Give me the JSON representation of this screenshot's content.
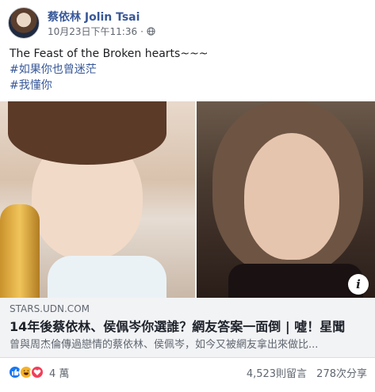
{
  "post": {
    "author": "蔡依林 Jolin Tsai",
    "timestamp": "10月23日下午11:36",
    "separator": "·",
    "privacy_icon": "globe-icon",
    "text_lines": [
      "The Feast of the Broken hearts~~~"
    ],
    "hashtags": [
      "#如果你也曾迷茫",
      "#我懂你"
    ]
  },
  "link_preview": {
    "domain": "STARS.UDN.COM",
    "title": "14年後蔡依林、侯佩岑你選誰？網友答案一面倒 | 噓！星聞",
    "description": "曾與周杰倫傳過戀情的蔡依林、侯佩岑，如今又被網友拿出來做比...",
    "info_icon": "i"
  },
  "reactions": {
    "icons": [
      "like-icon",
      "haha-icon",
      "love-icon"
    ],
    "count": "4 萬"
  },
  "stats": {
    "comments": "4,523則留言",
    "shares": "278次分享"
  },
  "colors": {
    "link_blue": "#385898",
    "meta_gray": "#616770",
    "preview_bg": "#f2f3f5",
    "like_blue": "#1877f2",
    "love_red": "#f33e58",
    "haha_yellow": "#f7b125"
  }
}
